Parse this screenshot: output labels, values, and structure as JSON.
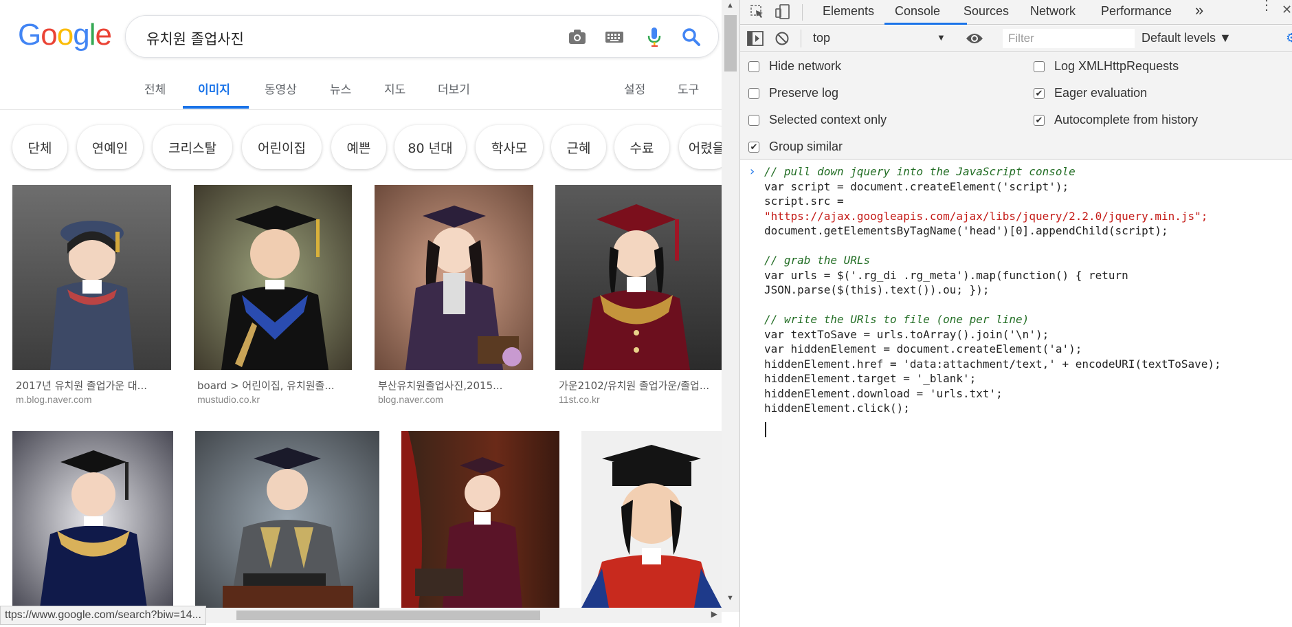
{
  "google": {
    "logo_letters": [
      "G",
      "o",
      "o",
      "g",
      "l",
      "e"
    ],
    "logo_colors": [
      "#4285F4",
      "#EA4335",
      "#FBBC05",
      "#4285F4",
      "#34A853",
      "#EA4335"
    ],
    "search_query": "유치원 졸업사진",
    "tabs": [
      "전체",
      "이미지",
      "동영상",
      "뉴스",
      "지도",
      "더보기",
      "설정",
      "도구"
    ],
    "chips": [
      "단체",
      "연예인",
      "크리스탈",
      "어린이집",
      "예쁜",
      "80 년대",
      "학사모",
      "근혜",
      "수료",
      "어렸을"
    ],
    "results_row1": [
      {
        "caption": "2017년 유치원 졸업가운 대...",
        "source": "m.blog.naver.com"
      },
      {
        "caption": "board > 어린이집, 유치원졸...",
        "source": "mustudio.co.kr"
      },
      {
        "caption": "부산유치원졸업사진,2015...",
        "source": "blog.naver.com"
      },
      {
        "caption": "가운2102/유치원 졸업가운/졸업...",
        "source": "11st.co.kr"
      }
    ],
    "status_url": "ttps://www.google.com/search?biw=14..."
  },
  "devtools": {
    "tabs": [
      "Elements",
      "Console",
      "Sources",
      "Network",
      "Performance"
    ],
    "more_label": "»",
    "context": "top",
    "filter_placeholder": "Filter",
    "levels": "Default levels ▼",
    "options": [
      {
        "label": "Hide network",
        "checked": false
      },
      {
        "label": "Log XMLHttpRequests",
        "checked": false
      },
      {
        "label": "Preserve log",
        "checked": false
      },
      {
        "label": "Eager evaluation",
        "checked": true
      },
      {
        "label": "Selected context only",
        "checked": false
      },
      {
        "label": "Autocomplete from history",
        "checked": true
      },
      {
        "label": "Group similar",
        "checked": true
      }
    ]
  },
  "console_lines": [
    "// pull down jquery into the JavaScript console",
    "var script = document.createElement('script');",
    "script.src =",
    "\"https://ajax.googleapis.com/ajax/libs/jquery/2.2.0/jquery.min.js\";",
    "document.getElementsByTagName('head')[0].appendChild(script);",
    "",
    "// grab the URLs",
    "var urls = $('.rg_di .rg_meta').map(function() { return",
    "JSON.parse($(this).text()).ou; });",
    "",
    "// write the URls to file (one per line)",
    "var textToSave = urls.toArray().join('\\n');",
    "var hiddenElement = document.createElement('a');",
    "hiddenElement.href = 'data:attachment/text,' + encodeURI(textToSave);",
    "hiddenElement.target = '_blank';",
    "hiddenElement.download = 'urls.txt';",
    "hiddenElement.click();"
  ]
}
